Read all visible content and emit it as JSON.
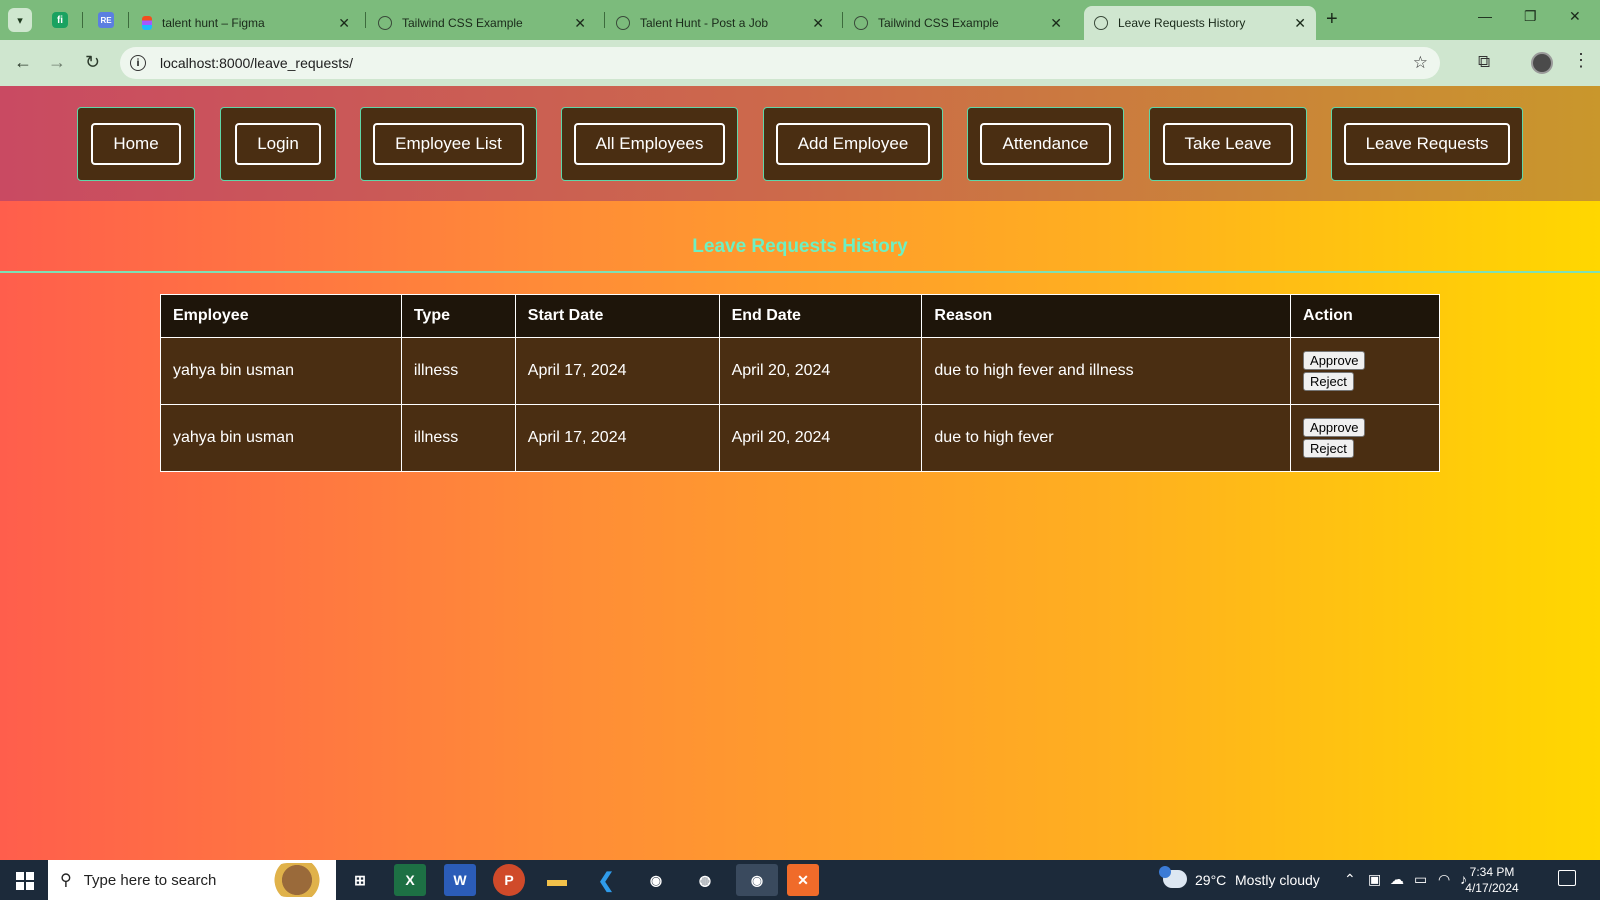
{
  "browser": {
    "tabs": [
      {
        "title": "talent hunt – Figma"
      },
      {
        "title": "Tailwind CSS Example"
      },
      {
        "title": "Talent Hunt - Post a Job"
      },
      {
        "title": "Tailwind CSS Example"
      },
      {
        "title": "Leave Requests History",
        "active": true
      }
    ],
    "url": "localhost:8000/leave_requests/"
  },
  "nav": {
    "items": [
      {
        "label": "Home"
      },
      {
        "label": "Login"
      },
      {
        "label": "Employee List"
      },
      {
        "label": "All Employees"
      },
      {
        "label": "Add Employee"
      },
      {
        "label": "Attendance"
      },
      {
        "label": "Take Leave"
      },
      {
        "label": "Leave Requests"
      }
    ]
  },
  "page": {
    "title": "Leave Requests History"
  },
  "table": {
    "headers": [
      "Employee",
      "Type",
      "Start Date",
      "End Date",
      "Reason",
      "Action"
    ],
    "rows": [
      {
        "employee": "yahya bin usman",
        "type": "illness",
        "start": "April 17, 2024",
        "end": "April 20, 2024",
        "reason": "due to high fever and illness"
      },
      {
        "employee": "yahya bin usman",
        "type": "illness",
        "start": "April 17, 2024",
        "end": "April 20, 2024",
        "reason": "due to high fever"
      }
    ],
    "approve_label": "Approve",
    "reject_label": "Reject"
  },
  "taskbar": {
    "search_placeholder": "Type here to search",
    "weather": {
      "temp": "29°C",
      "condition": "Mostly cloudy"
    },
    "time": "7:34 PM",
    "date": "4/17/2024"
  },
  "colors": {
    "accent_title": "#6ef0c2",
    "nav_card_bg": "#4a2e12",
    "table_header_bg": "#1e150a"
  }
}
